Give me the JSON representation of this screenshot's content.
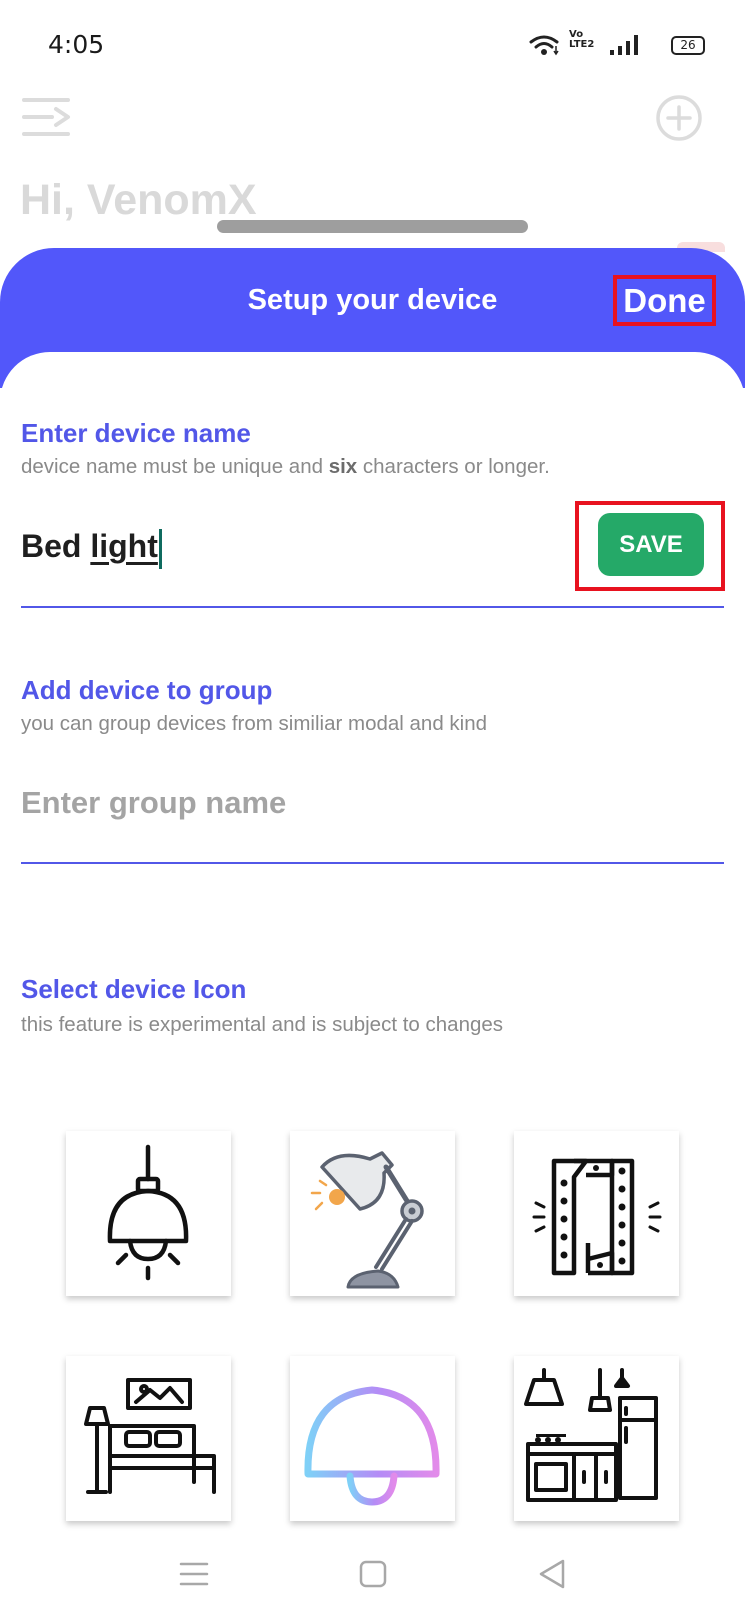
{
  "status_bar": {
    "time": "4:05",
    "volte": "Vo LTE2",
    "battery": "26",
    "icons": [
      "wifi-icon",
      "volte-icon",
      "signal-icon",
      "battery-icon"
    ]
  },
  "background_app": {
    "greeting": "Hi, VenomX",
    "icons": [
      "menu-icon",
      "add-circle-icon"
    ]
  },
  "sheet": {
    "title": "Setup your device",
    "done_label": "Done",
    "device_name": {
      "title": "Enter device name",
      "hint_before": "device name must be unique and ",
      "hint_bold": "six",
      "hint_after": " characters or longer.",
      "value_word1": "Bed",
      "value_word2": "light",
      "save_label": "SAVE"
    },
    "group": {
      "title": "Add device to group",
      "hint": "you can group devices from similiar modal and kind",
      "placeholder": "Enter group name",
      "value": ""
    },
    "icon_select": {
      "title": "Select device Icon",
      "hint": "this feature is experimental and is subject to changes",
      "icons": [
        "pendant-lamp-icon",
        "desk-lamp-icon",
        "led-strip-icon",
        "bedroom-icon",
        "gradient-ceiling-lamp-icon",
        "kitchen-icon"
      ]
    }
  },
  "colors": {
    "accent": "#5257FA",
    "section_title": "#5257E8",
    "save_button": "#25A968",
    "highlight": "#E8121F"
  },
  "nav_bar": {
    "icons": [
      "recents-icon",
      "home-icon",
      "back-icon"
    ]
  }
}
